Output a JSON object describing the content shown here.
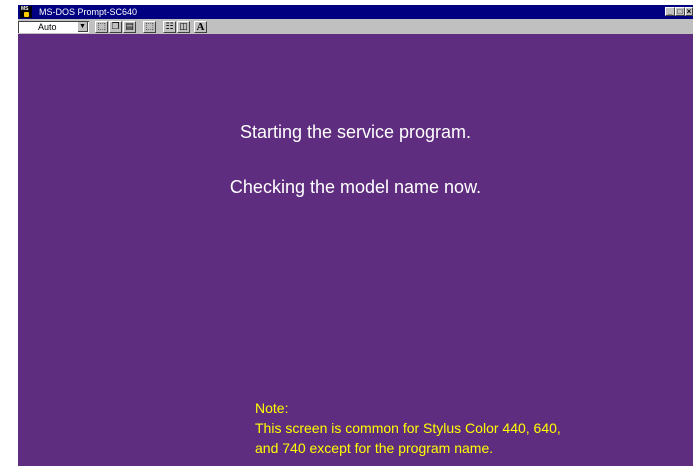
{
  "window": {
    "title": "MS-DOS Prompt-SC640",
    "icon_label": "MS",
    "buttons": {
      "minimize": "_",
      "maximize": "□",
      "close": "×"
    }
  },
  "toolbar": {
    "font_size_value": "Auto",
    "buttons": [
      {
        "name": "mark",
        "glyph": "⬚"
      },
      {
        "name": "copy",
        "glyph": "❐"
      },
      {
        "name": "paste",
        "glyph": "▤"
      },
      {
        "name": "full-screen",
        "glyph": "⬚"
      },
      {
        "name": "properties",
        "glyph": "☷"
      },
      {
        "name": "background",
        "glyph": "◫"
      },
      {
        "name": "font",
        "glyph": "A"
      }
    ]
  },
  "screen": {
    "line1": "Starting the service program.",
    "line2": "Checking the model name now.",
    "note_heading": "Note:",
    "note_line1": "This screen is common for Stylus Color 440, 640,",
    "note_line2": "and 740 except for the program name."
  },
  "colors": {
    "background": "#5f2d7f",
    "text": "#ffffff",
    "note": "#ffff00",
    "titlebar": "#000080"
  }
}
